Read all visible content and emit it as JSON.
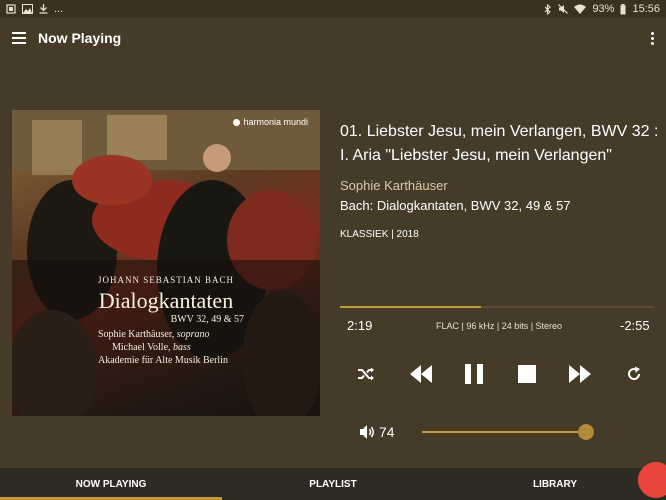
{
  "status_bar": {
    "left_text": "...",
    "battery": "93%",
    "time": "15:56",
    "icons": [
      "notification-icon",
      "image-icon",
      "download-icon",
      "bluetooth-icon",
      "mute-icon",
      "wifi-icon",
      "battery-icon"
    ]
  },
  "app_bar": {
    "title": "Now Playing",
    "menu_icon": "hamburger-menu-icon",
    "overflow_icon": "more-vert-icon"
  },
  "cover": {
    "label": "harmonia mundi",
    "composer": "JOHANN SEBASTIAN BACH",
    "title": "Dialogkantaten",
    "subtitle": "BWV 32, 49 & 57",
    "credit_1_name": "Sophie Karthäuser,",
    "credit_1_role": "soprano",
    "credit_2_name": "Michael Volle,",
    "credit_2_role": "bass",
    "credit_3": "Akademie für Alte Musik Berlin"
  },
  "track": {
    "title": "01. Liebster Jesu, mein Verlangen, BWV 32 : I. Aria \"Liebster Jesu, mein Verlangen\"",
    "artist": "Sophie Karthäuser",
    "album": "Bach: Dialogkantaten, BWV 32, 49 & 57",
    "meta": "KLASSIEK | 2018"
  },
  "playback": {
    "elapsed": "2:19",
    "remaining": "-2:55",
    "format": "FLAC | 96 kHz | 24 bits | Stereo",
    "progress_fraction": 0.45
  },
  "controls": {
    "shuffle_icon": "shuffle-icon",
    "previous_icon": "skip-previous-icon",
    "play_pause_icon": "pause-icon",
    "stop_icon": "stop-icon",
    "next_icon": "skip-next-icon",
    "repeat_icon": "repeat-icon"
  },
  "volume": {
    "value": "74",
    "level_fraction": 1.0
  },
  "bottom_nav": {
    "tabs": [
      {
        "label": "NOW PLAYING",
        "active": true
      },
      {
        "label": "PLAYLIST",
        "active": false
      },
      {
        "label": "LIBRARY",
        "active": false
      }
    ]
  },
  "colors": {
    "background": "#463b28",
    "accent": "#c29a3a",
    "nav_bg": "#2e2a24",
    "fab": "#e8453c"
  }
}
